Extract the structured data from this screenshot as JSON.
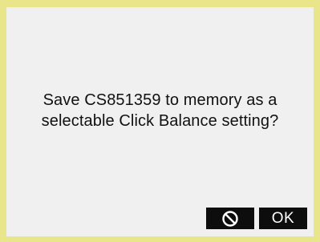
{
  "dialog": {
    "message_line1": "Save CS851359 to memory as a",
    "message_line2": "selectable Click Balance setting?",
    "cancel_icon": "prohibited-icon",
    "ok_label": "OK"
  },
  "colors": {
    "border": "#e8e58a",
    "background": "#f0f0f0",
    "button_bg": "#0d0d0d",
    "button_fg": "#ffffff",
    "text": "#111111"
  }
}
